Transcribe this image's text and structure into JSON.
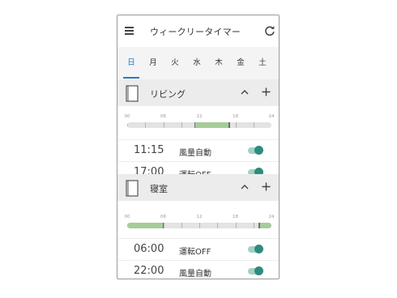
{
  "app": {
    "title": "ウィークリータイマー",
    "icons": {
      "menu": "hamburger-menu-icon",
      "refresh": "refresh-icon"
    }
  },
  "days": [
    {
      "label": "日",
      "selected": true
    },
    {
      "label": "月",
      "selected": false
    },
    {
      "label": "火",
      "selected": false
    },
    {
      "label": "水",
      "selected": false
    },
    {
      "label": "木",
      "selected": false
    },
    {
      "label": "金",
      "selected": false
    },
    {
      "label": "土",
      "selected": false
    }
  ],
  "timeline_ticks": [
    "00",
    "06",
    "12",
    "18",
    "24"
  ],
  "rooms": [
    {
      "name": "リビング",
      "on_ranges": [
        [
          11.25,
          17.0
        ]
      ],
      "timers": [
        {
          "time": "11:15",
          "mode": "風量自動",
          "enabled": true
        },
        {
          "time": "17:00",
          "mode": "運転OFF",
          "enabled": true
        }
      ]
    },
    {
      "name": "寝室",
      "on_ranges": [
        [
          0,
          6.0
        ],
        [
          22.0,
          24
        ]
      ],
      "timers": [
        {
          "time": "06:00",
          "mode": "運転OFF",
          "enabled": true
        },
        {
          "time": "22:00",
          "mode": "風量自動",
          "enabled": true
        }
      ]
    }
  ],
  "colors": {
    "accent": "#2a78c2",
    "toggle_on": "#2e8b7d",
    "timeline_on": "#a6cc9a"
  }
}
